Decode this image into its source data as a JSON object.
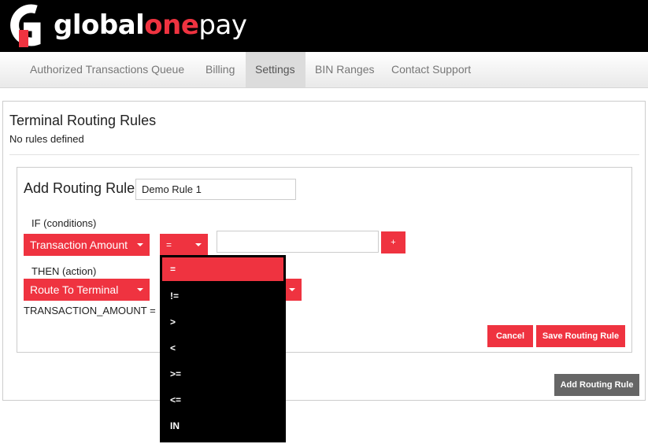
{
  "brand": {
    "part1": "global",
    "part2": "one",
    "part3": "pay"
  },
  "nav": {
    "items": [
      {
        "label": "Authorized Transactions Queue"
      },
      {
        "label": "Billing"
      },
      {
        "label": "Settings"
      },
      {
        "label": "BIN Ranges"
      },
      {
        "label": "Contact Support"
      }
    ],
    "active_label": "Settings"
  },
  "routing": {
    "title": "Terminal Routing Rules",
    "empty_text": "No rules defined",
    "add_rule": {
      "title": "Add Routing Rule",
      "name_value": "Demo Rule 1",
      "if_label": "IF (conditions)",
      "condition_field": "Transaction Amount",
      "operator": "=",
      "condition_value": "",
      "add_condition_label": "+",
      "then_label": "THEN (action)",
      "action": "Route To Terminal",
      "summary": "TRANSACTION_AMOUNT =",
      "cancel_label": "Cancel",
      "save_label": "Save Routing Rule"
    },
    "add_button_label": "Add Routing Rule"
  },
  "operator_dropdown": {
    "options": [
      "=",
      "!=",
      ">",
      "<",
      ">=",
      "<=",
      "IN"
    ],
    "selected": "="
  },
  "colors": {
    "accent": "#ef3340",
    "header_bg": "#000000",
    "secondary_button": "#666666"
  }
}
